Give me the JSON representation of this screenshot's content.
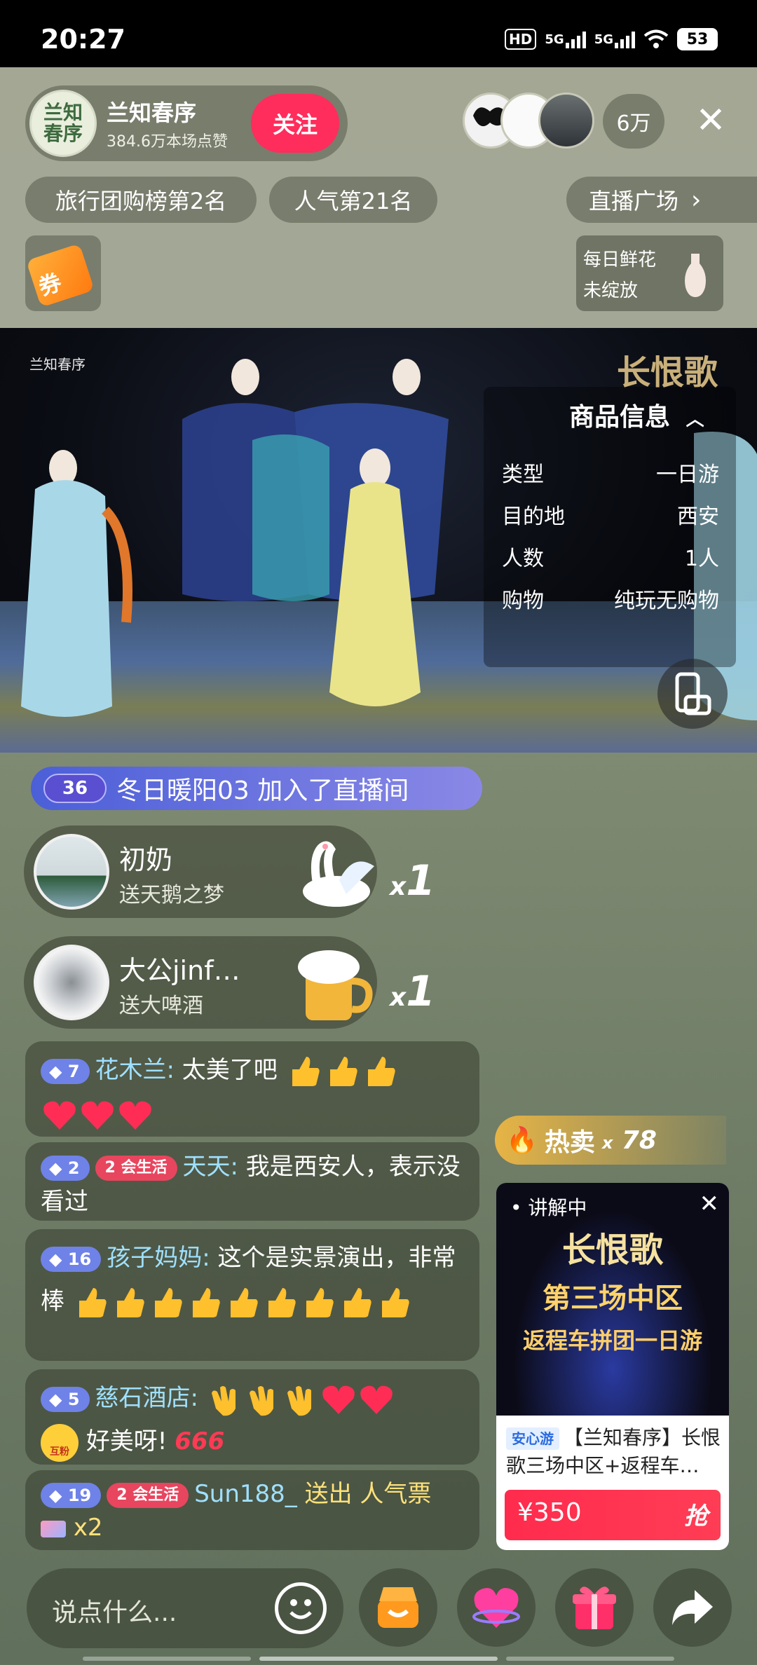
{
  "status_bar": {
    "time": "20:27",
    "hd_label": "HD",
    "net1": "5G",
    "net2": "5G",
    "battery": "53"
  },
  "host": {
    "avatar_text": "兰知\n春序",
    "name": "兰知春序",
    "likes": "384.6万本场点赞",
    "follow_label": "关注"
  },
  "viewers": {
    "count": "6万"
  },
  "tags": {
    "rank1": "旅行团购榜第2名",
    "rank2": "人气第21名",
    "plaza": "直播广场"
  },
  "coupon": {
    "label": "券"
  },
  "flower": {
    "line1": "每日鲜花",
    "line2": "未绽放"
  },
  "video": {
    "logo": "兰知春序",
    "title": "长恨歌",
    "product_header": "商品信息",
    "product_rows": [
      {
        "key": "类型",
        "value": "一日游"
      },
      {
        "key": "目的地",
        "value": "西安"
      },
      {
        "key": "人数",
        "value": "1人"
      },
      {
        "key": "购物",
        "value": "纯玩无购物"
      }
    ]
  },
  "join": {
    "level": "36",
    "text": "冬日暖阳03 加入了直播间"
  },
  "gifts": [
    {
      "name": "初奶",
      "desc": "送天鹅之梦",
      "x": "x",
      "count": "1"
    },
    {
      "name": "大公jinf…",
      "desc": "送大啤酒",
      "x": "x",
      "count": "1"
    }
  ],
  "chat": [
    {
      "level": "7",
      "name": "花木兰:",
      "text": "太美了吧"
    },
    {
      "level": "2",
      "club_lv": "2",
      "club": "会生活",
      "name": "天天:",
      "text": "我是西安人，表示没看过"
    },
    {
      "level": "16",
      "name": "孩子妈妈:",
      "text": "这个是实景演出，非常棒"
    },
    {
      "level": "5",
      "name": "慈石酒店:",
      "badge": "互粉",
      "text": "好美呀!",
      "emoji_text": "666"
    },
    {
      "level": "19",
      "club_lv": "2",
      "club": "会生活",
      "name": "Sun188_",
      "text": "送出 人气票",
      "count": "x2"
    }
  ],
  "hot": {
    "label": "热卖",
    "x": "x",
    "count": "78",
    "live_label": "讲解中",
    "art1": "长恨歌",
    "art2": "第三场中区",
    "art3": "返程车拼团一日游",
    "safe": "安心游",
    "desc": "【兰知春序】长恨歌三场中区+返程车…",
    "price": "¥350",
    "buy": "抢"
  },
  "bottom": {
    "placeholder": "说点什么..."
  },
  "colors": {
    "follow": "#ff2d5c",
    "join": "#4b5fd8",
    "buy": "#ff2b4d"
  }
}
